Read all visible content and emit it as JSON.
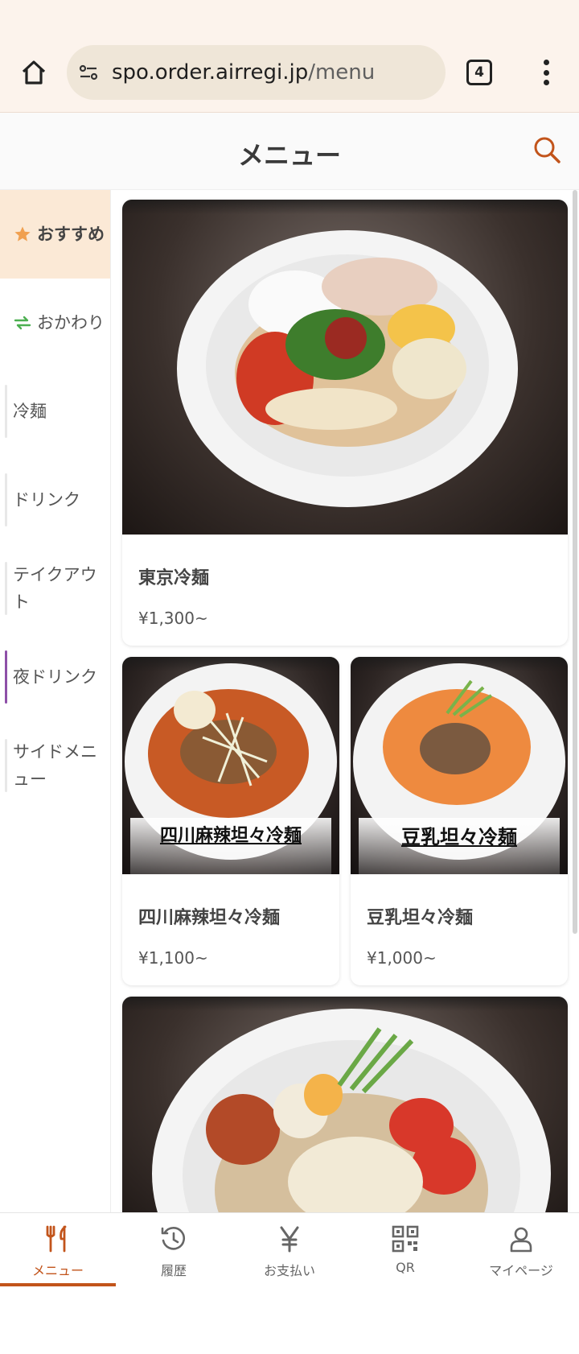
{
  "browser": {
    "url_host": "spo.order.airregi.jp",
    "url_path": "/menu",
    "tab_count": "4"
  },
  "header": {
    "title": "メニュー"
  },
  "sidebar": {
    "items": [
      {
        "label": "おすすめ",
        "icon": "star-icon"
      },
      {
        "label": "おかわり",
        "icon": "refresh-icon"
      },
      {
        "label": "冷麺"
      },
      {
        "label": "ドリンク"
      },
      {
        "label": "テイクアウト"
      },
      {
        "label": "夜ドリンク"
      },
      {
        "label": "サイドメニュー"
      }
    ]
  },
  "cards": [
    {
      "name": "東京冷麺",
      "price": "¥1,300~"
    },
    {
      "name": "四川麻辣坦々冷麺",
      "price": "¥1,100~",
      "image_caption": "四川麻辣坦々冷麺"
    },
    {
      "name": "豆乳坦々冷麺",
      "price": "¥1,000~",
      "image_caption": "豆乳坦々冷麺"
    }
  ],
  "bottom_nav": [
    {
      "label": "メニュー",
      "icon": "fork-knife-icon"
    },
    {
      "label": "履歴",
      "icon": "history-icon"
    },
    {
      "label": "お支払い",
      "icon": "yen-icon"
    },
    {
      "label": "QR",
      "icon": "qr-icon"
    },
    {
      "label": "マイページ",
      "icon": "person-icon"
    }
  ],
  "colors": {
    "accent": "#c2541b",
    "sidebar_active_bg": "#fbe9d6",
    "night_drink_bar": "#8e4fa8",
    "star": "#f0a050",
    "refresh": "#4caf50"
  }
}
